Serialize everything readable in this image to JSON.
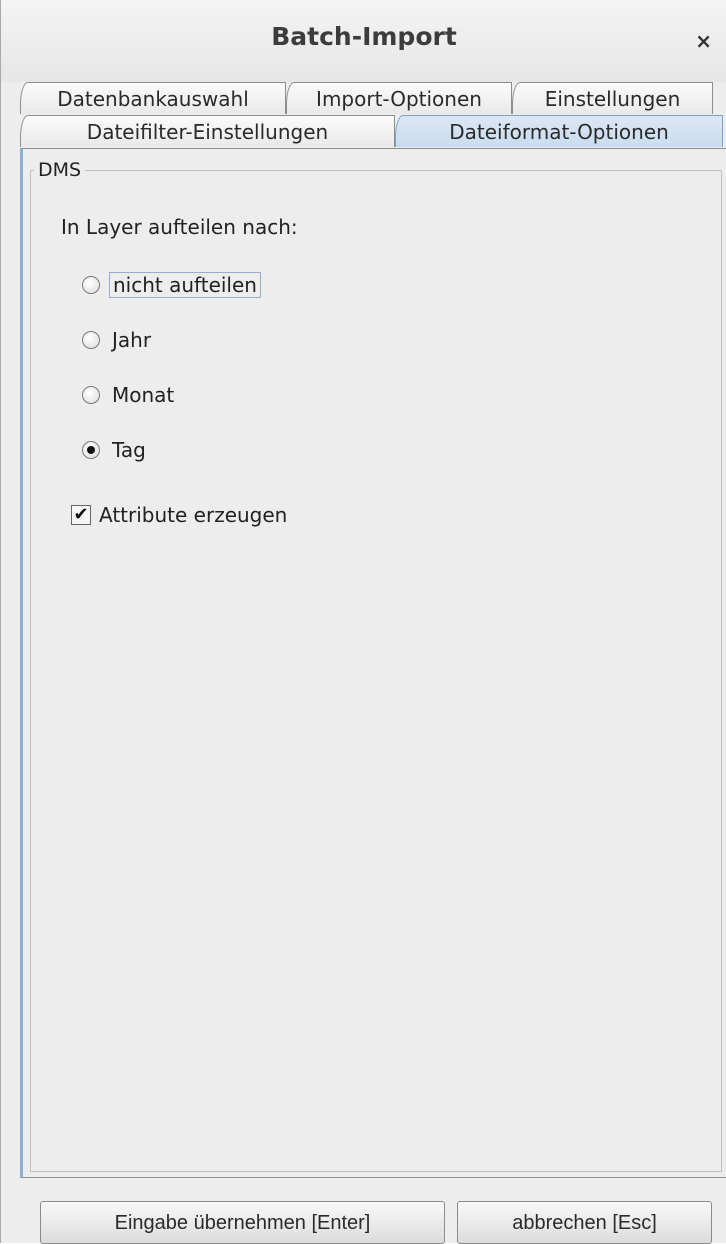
{
  "window": {
    "title": "Batch-Import",
    "close_symbol": "×"
  },
  "tabs": {
    "row1": [
      {
        "label": "Datenbankauswahl"
      },
      {
        "label": "Import-Optionen"
      },
      {
        "label": "Einstellungen"
      }
    ],
    "row2": [
      {
        "label": "Dateifilter-Einstellungen"
      },
      {
        "label": "Dateiformat-Optionen",
        "selected": true
      }
    ]
  },
  "panel": {
    "group_title": "DMS",
    "split_label": "In Layer aufteilen nach:",
    "split_options": [
      {
        "label": "nicht aufteilen",
        "checked": false,
        "focused": true
      },
      {
        "label": "Jahr",
        "checked": false
      },
      {
        "label": "Monat",
        "checked": false
      },
      {
        "label": "Tag",
        "checked": true
      }
    ],
    "attributes_checkbox": {
      "label": "Attribute erzeugen",
      "checked": true,
      "mark": "✔"
    }
  },
  "buttons": {
    "ok_label": "Eingabe übernehmen [Enter]",
    "cancel_label": "abbrechen [Esc]"
  }
}
